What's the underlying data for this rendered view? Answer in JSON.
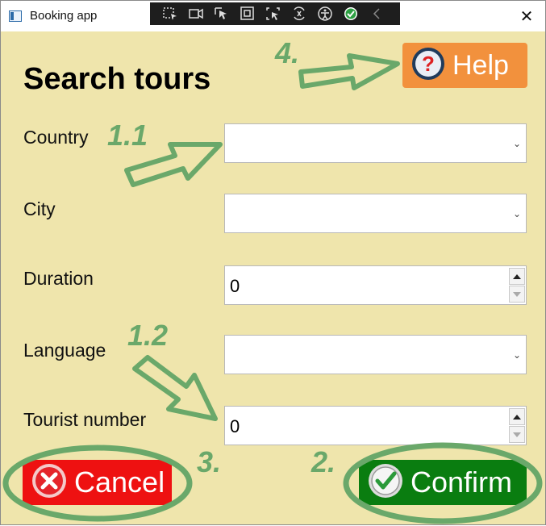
{
  "window": {
    "title": "Booking app",
    "close_label": "✕"
  },
  "devtools": {
    "icons": [
      "select-element-icon",
      "record-icon",
      "pointer-icon",
      "display-layout-icon",
      "track-focus-icon",
      "hot-reload-icon",
      "accessibility-icon",
      "binding-check-icon",
      "collapse-chevron-icon"
    ]
  },
  "form": {
    "heading": "Search tours",
    "help_label": "Help",
    "fields": {
      "country": {
        "label": "Country",
        "value": ""
      },
      "city": {
        "label": "City",
        "value": ""
      },
      "duration": {
        "label": "Duration",
        "value": "0"
      },
      "language": {
        "label": "Language",
        "value": ""
      },
      "tourist_number": {
        "label": "Tourist number",
        "value": "0"
      }
    },
    "cancel_label": "Cancel",
    "confirm_label": "Confirm"
  },
  "annotations": {
    "step_1_1": "1.1",
    "step_1_2": "1.2",
    "step_2": "2.",
    "step_3": "3.",
    "step_4": "4."
  },
  "colors": {
    "background": "#efe5ac",
    "help": "#f2913d",
    "cancel": "#ee1111",
    "confirm": "#0a7d10",
    "annotation": "#6aa86a"
  }
}
